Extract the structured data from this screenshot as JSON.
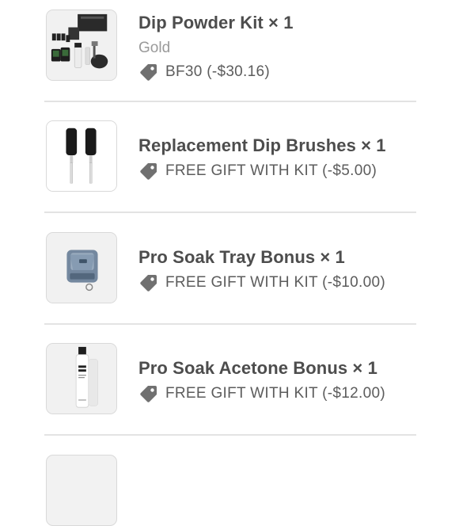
{
  "items": [
    {
      "title": "Dip Powder Kit × 1",
      "variant": "Gold",
      "discount": "BF30 (-$30.16)",
      "image_icon": "dip-powder-kit-image"
    },
    {
      "title": "Replacement Dip Brushes × 1",
      "discount": "FREE GIFT WITH KIT (-$5.00)",
      "image_icon": "dip-brushes-image"
    },
    {
      "title": "Pro Soak Tray Bonus × 1",
      "discount": "FREE GIFT WITH KIT (-$10.00)",
      "image_icon": "soak-tray-image"
    },
    {
      "title": "Pro Soak Acetone Bonus × 1",
      "discount": "FREE GIFT WITH KIT (-$12.00)",
      "image_icon": "acetone-bottle-image"
    }
  ],
  "icons": {
    "discount": "tag-icon"
  },
  "colors": {
    "text": "#4d4d4d",
    "muted": "#9a9a9a",
    "divider": "#e3e3e3",
    "tag": "#707070"
  }
}
